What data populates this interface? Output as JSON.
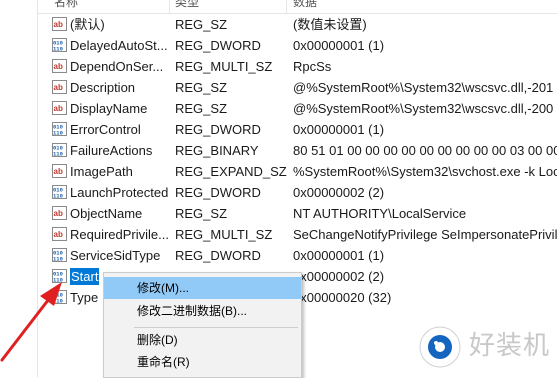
{
  "header": {
    "col_name": "名称",
    "col_type": "类型",
    "col_data": "数据"
  },
  "rows": [
    {
      "icon": "string-value-icon",
      "name": "(默认)",
      "type": "REG_SZ",
      "data": "(数值未设置)"
    },
    {
      "icon": "binary-value-icon",
      "name": "DelayedAutoSt...",
      "type": "REG_DWORD",
      "data": "0x00000001 (1)"
    },
    {
      "icon": "string-value-icon",
      "name": "DependOnSer...",
      "type": "REG_MULTI_SZ",
      "data": "RpcSs"
    },
    {
      "icon": "string-value-icon",
      "name": "Description",
      "type": "REG_SZ",
      "data": "@%SystemRoot%\\System32\\wscsvc.dll,-201"
    },
    {
      "icon": "string-value-icon",
      "name": "DisplayName",
      "type": "REG_SZ",
      "data": "@%SystemRoot%\\System32\\wscsvc.dll,-200"
    },
    {
      "icon": "binary-value-icon",
      "name": "ErrorControl",
      "type": "REG_DWORD",
      "data": "0x00000001 (1)"
    },
    {
      "icon": "binary-value-icon",
      "name": "FailureActions",
      "type": "REG_BINARY",
      "data": "80 51 01 00 00 00 00 00 00 00 00 00 03 00 00"
    },
    {
      "icon": "string-value-icon",
      "name": "ImagePath",
      "type": "REG_EXPAND_SZ",
      "data": "%SystemRoot%\\System32\\svchost.exe -k Loc"
    },
    {
      "icon": "binary-value-icon",
      "name": "LaunchProtected",
      "type": "REG_DWORD",
      "data": "0x00000002 (2)"
    },
    {
      "icon": "string-value-icon",
      "name": "ObjectName",
      "type": "REG_SZ",
      "data": "NT AUTHORITY\\LocalService"
    },
    {
      "icon": "string-value-icon",
      "name": "RequiredPrivile...",
      "type": "REG_MULTI_SZ",
      "data": "SeChangeNotifyPrivilege SeImpersonatePrivil"
    },
    {
      "icon": "binary-value-icon",
      "name": "ServiceSidType",
      "type": "REG_DWORD",
      "data": "0x00000001 (1)"
    },
    {
      "icon": "binary-value-icon",
      "name": "Start",
      "type": "",
      "data": "0x00000002 (2)"
    },
    {
      "icon": "binary-value-icon",
      "name": "Type",
      "type": "",
      "data": "0x00000020 (32)"
    }
  ],
  "context_menu": {
    "items": [
      "修改(M)...",
      "修改二进制数据(B)...",
      "删除(D)",
      "重命名(R)"
    ]
  },
  "watermark": {
    "text": "好装机"
  },
  "colors": {
    "selection": "#0078d7",
    "menu_highlight": "#91c9f7",
    "arrow": "#e02020"
  }
}
